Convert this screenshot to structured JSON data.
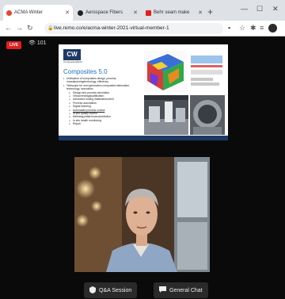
{
  "browser": {
    "tabs": [
      {
        "label": "ACMA Winter",
        "color": "#e94335",
        "active": true
      },
      {
        "label": "Aerospace Fibers",
        "color": "#222222",
        "active": false
      },
      {
        "label": "Behr seam make",
        "color": "#e02020",
        "active": false
      }
    ],
    "url": "live.remo.co/e/acma-winter-2021-virtual-member-1"
  },
  "stream": {
    "live_badge": "LIVE",
    "viewer_count": "101"
  },
  "slide": {
    "logo": "CW",
    "logo_sub": "CompositesWorld",
    "title": "Composites 5.0",
    "bullets": [
      {
        "level": 1,
        "text": "Unification of composites design, process, manufacturing/metrology, efficiency"
      },
      {
        "level": 1,
        "text": "Telescope for next generation composites fabrication, technology, innovation"
      },
      {
        "level": 2,
        "text": "Design and process simulation"
      },
      {
        "level": 2,
        "text": "Virtual testing/qualification"
      },
      {
        "level": 2,
        "text": "Advanced tooling materials/control"
      },
      {
        "level": 2,
        "text": "Process automation"
      },
      {
        "level": 2,
        "text": "Digital twinning"
      },
      {
        "level": 2,
        "text": "Automated process control",
        "underline": true
      },
      {
        "level": 2,
        "text": "In situ quality control"
      },
      {
        "level": 2,
        "text": "Metrology/data fusion/prediction"
      },
      {
        "level": 2,
        "text": "In situ health monitoring"
      },
      {
        "level": 2,
        "text": "Repair"
      }
    ]
  },
  "buttons": {
    "qa_label": "Q&A Session",
    "chat_label": "General Chat"
  }
}
